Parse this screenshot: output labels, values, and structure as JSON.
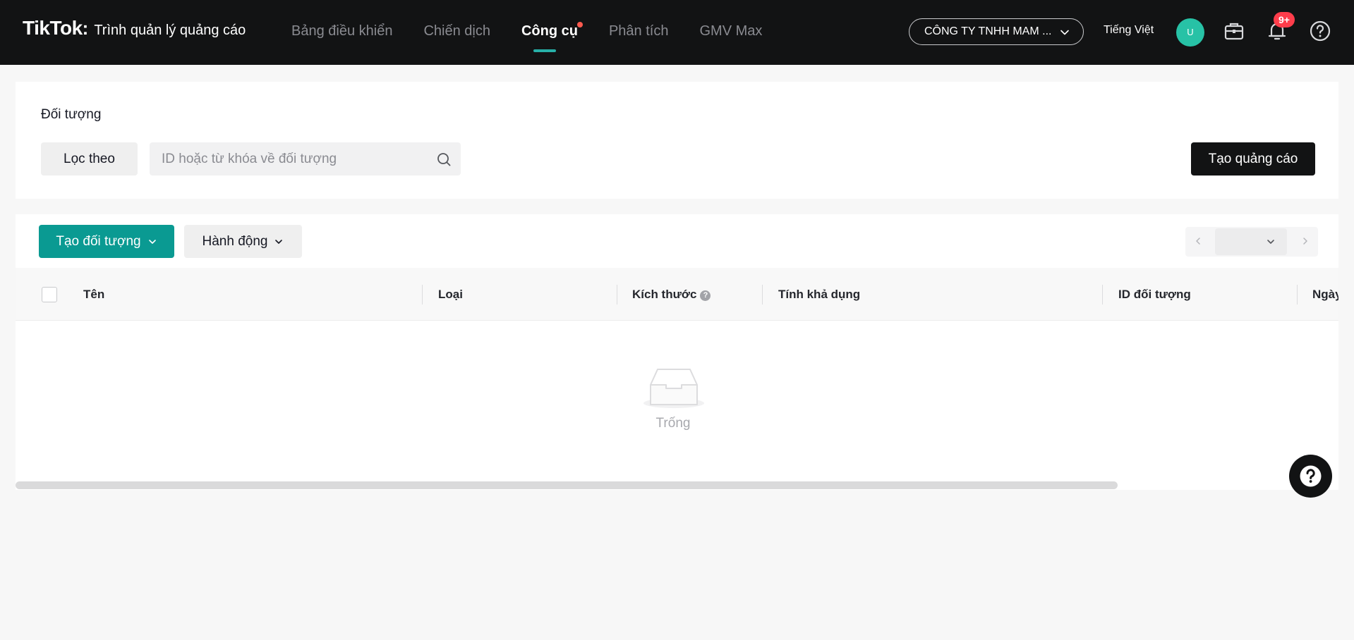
{
  "header": {
    "logo_text": "TikTok",
    "logo_separator": ":",
    "logo_subtitle": "Trình quản lý quảng cáo",
    "nav": [
      {
        "label": "Bảng điều khiển",
        "active": false
      },
      {
        "label": "Chiến dịch",
        "active": false
      },
      {
        "label": "Công cụ",
        "active": true,
        "has_dot": true
      },
      {
        "label": "Phân tích",
        "active": false
      },
      {
        "label": "GMV Max",
        "active": false
      }
    ],
    "account_name": "CÔNG TY TNHH MAM ...",
    "language": "Tiếng Việt",
    "avatar_initial": "U",
    "notification_count": "9+"
  },
  "filter_panel": {
    "title": "Đối tượng",
    "filter_button": "Lọc theo",
    "search_placeholder": "ID hoặc từ khóa về đối tượng",
    "create_ad_button": "Tạo quảng cáo"
  },
  "table_panel": {
    "create_audience_button": "Tạo đối tượng",
    "actions_button": "Hành động",
    "columns": [
      "Tên",
      "Loại",
      "Kích thước",
      "Tính khả dụng",
      "ID đối tượng",
      "Ngày"
    ],
    "size_help_glyph": "?",
    "empty_text": "Trống"
  },
  "colors": {
    "topbar": "#121314",
    "accent_teal": "#0a9a92",
    "badge_red": "#fe3d4b",
    "avatar": "#27c2a6"
  },
  "icons": [
    "chevron-down-icon",
    "briefcase-icon",
    "bell-icon",
    "help-circle-icon",
    "search-icon",
    "chevron-left-icon",
    "chevron-right-icon",
    "empty-inbox-icon",
    "question-icon"
  ]
}
